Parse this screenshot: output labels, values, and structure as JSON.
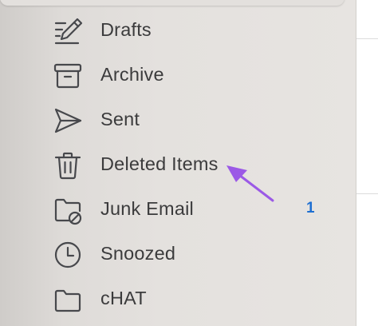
{
  "folders": [
    {
      "label": "Drafts",
      "icon": "drafts-icon"
    },
    {
      "label": "Archive",
      "icon": "archive-icon"
    },
    {
      "label": "Sent",
      "icon": "sent-icon"
    },
    {
      "label": "Deleted Items",
      "icon": "trash-icon"
    },
    {
      "label": "Junk Email",
      "icon": "junk-folder-icon",
      "unread_count": "1"
    },
    {
      "label": "Snoozed",
      "icon": "clock-icon"
    },
    {
      "label": "cHAT",
      "icon": "folder-icon"
    }
  ],
  "colors": {
    "sidebar_bg": "#e4e1de",
    "label_text": "#3b3b3c",
    "icon_stroke": "#47484c",
    "badge": "#1e6fd1",
    "annotation_arrow": "#9b59e6"
  }
}
